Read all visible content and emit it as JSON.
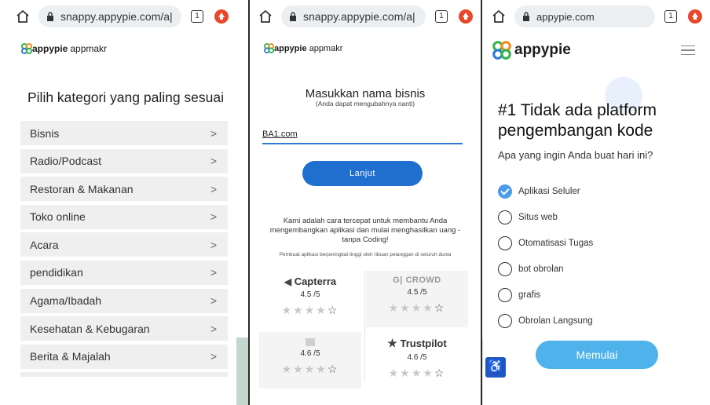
{
  "browser": {
    "panel1_url": "snappy.appypie.com/a|",
    "panel2_url": "snappy.appypie.com/a|",
    "panel3_url": "appypie.com",
    "tab_count": "1"
  },
  "panel1": {
    "logo_text": "appypie",
    "logo_sub": "appmakr",
    "heading": "Pilih kategori yang paling sesuai",
    "categories": [
      {
        "label": "Bisnis",
        "arrow": ">"
      },
      {
        "label": "Radio/Podcast",
        "arrow": ">"
      },
      {
        "label": "Restoran & Makanan",
        "arrow": ">"
      },
      {
        "label": "Toko online",
        "arrow": ">"
      },
      {
        "label": "Acara",
        "arrow": ">"
      },
      {
        "label": "pendidikan",
        "arrow": ">"
      },
      {
        "label": "Agama/Ibadah",
        "arrow": ">"
      },
      {
        "label": "Kesehatan & Kebugaran",
        "arrow": ">"
      },
      {
        "label": "Berita & Majalah",
        "arrow": ">"
      }
    ]
  },
  "panel2": {
    "logo_text": "appypie",
    "logo_sub": "appmakr",
    "title": "Masukkan nama bisnis",
    "subtitle": "(Anda dapat mengubahnya nanti)",
    "input_value": "BA1.com",
    "button_label": "Lanjut",
    "pitch": "Kami adalah cara tercepat untuk membantu Anda mengembangkan aplikasi dan mulai menghasilkan uang - tanpa Coding!",
    "small_note": "Pembuat aplikasi berperingkat tinggi oleh ribuan pelanggan di seluruh dunia",
    "reviews": [
      {
        "brand": "Capterra",
        "rating": "4.5 /5",
        "stars": "★★★★",
        "last_star": "☆"
      },
      {
        "brand": "CROWD",
        "rating": "4.5 /5",
        "stars": "★★★★",
        "last_star": "☆"
      },
      {
        "brand": "",
        "rating": "4.6 /5",
        "stars": "★★★★",
        "last_star": "☆"
      },
      {
        "brand": "Trustpilot",
        "rating": "4.6 /5",
        "stars": "★★★★",
        "last_star": "☆"
      }
    ]
  },
  "panel3": {
    "logo_text": "appypie",
    "title": "#1 Tidak ada platform pengembangan kode",
    "question": "Apa yang ingin Anda buat hari ini?",
    "options": [
      {
        "label": "Aplikasi Seluler",
        "selected": true
      },
      {
        "label": "Situs web",
        "selected": false
      },
      {
        "label": "Otomatisasi Tugas",
        "selected": false
      },
      {
        "label": "bot obrolan",
        "selected": false
      },
      {
        "label": "grafis",
        "selected": false
      },
      {
        "label": "Obrolan Langsung",
        "selected": false
      }
    ],
    "button_label": "Memulai"
  },
  "colors": {
    "primary_blue": "#1f6fcf",
    "light_blue": "#4fb2ea",
    "alert_red": "#e8472b",
    "logo_green": "#2fb34a",
    "logo_orange": "#f28c1b",
    "logo_blue": "#2d7be0"
  },
  "icons": [
    "home-icon",
    "lock-icon",
    "tab-switcher-icon",
    "alert-icon",
    "hamburger-menu-icon",
    "accessibility-icon",
    "checkmark-icon"
  ]
}
